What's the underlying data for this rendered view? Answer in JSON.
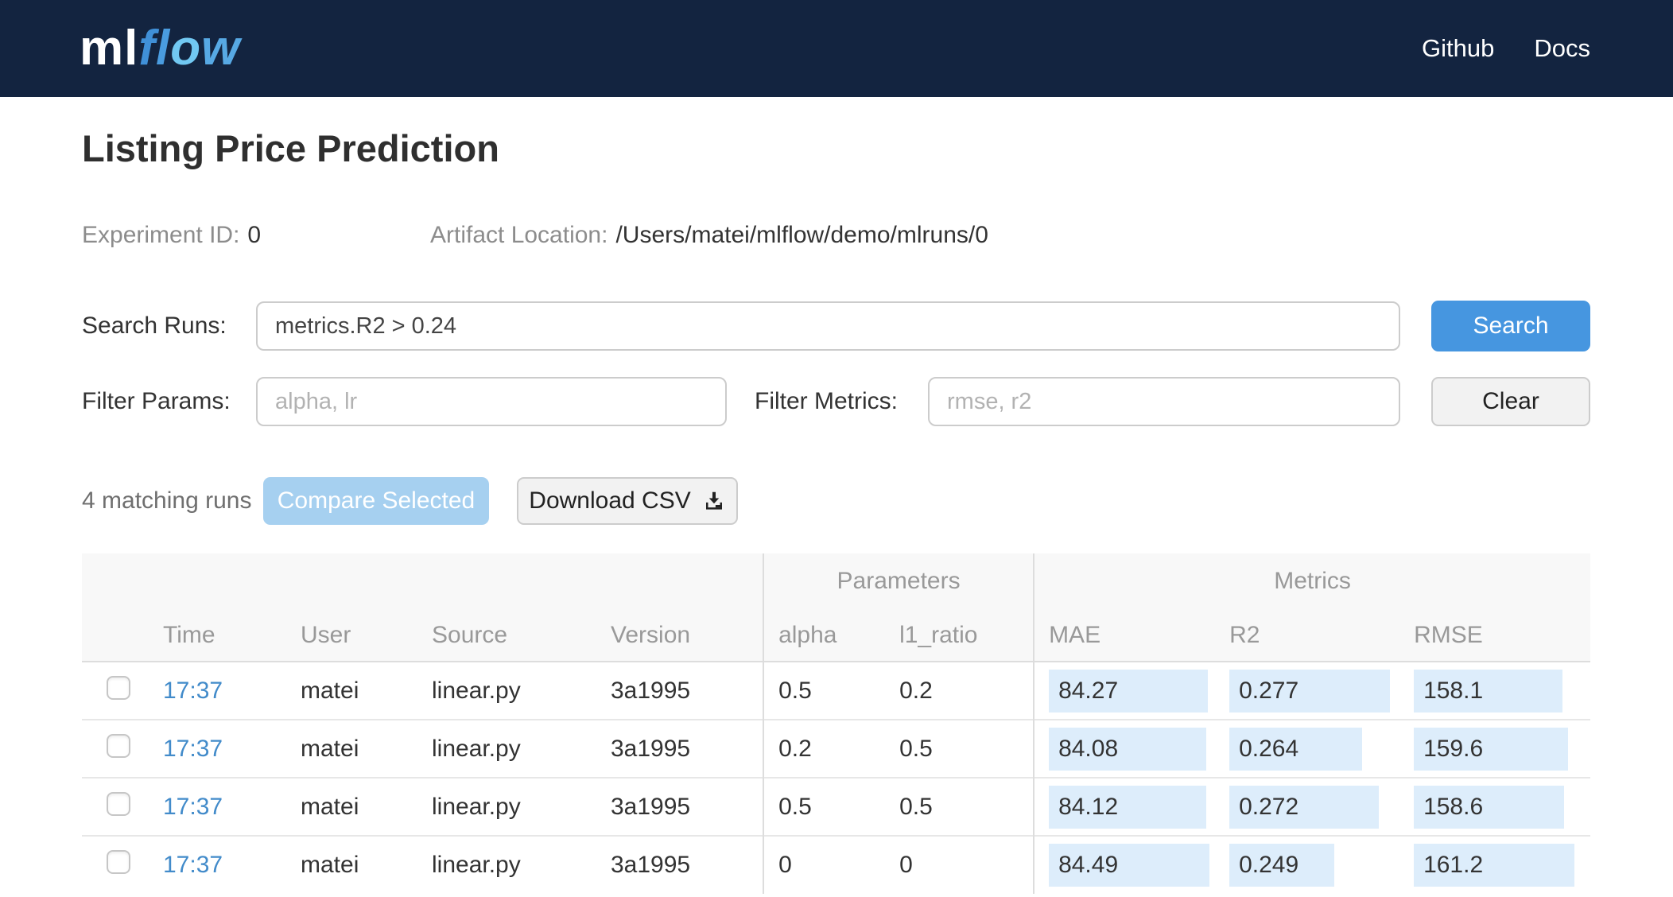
{
  "navbar": {
    "logo": {
      "ml": "ml",
      "flow_letters": [
        "f",
        "l",
        "o",
        "w"
      ]
    },
    "links": [
      {
        "label": "Github"
      },
      {
        "label": "Docs"
      }
    ]
  },
  "header": {
    "title": "Listing Price Prediction",
    "experiment_id_label": "Experiment ID:",
    "experiment_id_value": "0",
    "artifact_location_label": "Artifact Location:",
    "artifact_location_value": "/Users/matei/mlflow/demo/mlruns/0"
  },
  "search": {
    "label": "Search Runs:",
    "value": "metrics.R2 > 0.24",
    "button_label": "Search"
  },
  "filters": {
    "params_label": "Filter Params:",
    "params_placeholder": "alpha, lr",
    "metrics_label": "Filter Metrics:",
    "metrics_placeholder": "rmse, r2",
    "clear_button_label": "Clear"
  },
  "actions": {
    "matching_runs_text": "4 matching runs",
    "compare_button_label": "Compare Selected",
    "download_button_label": "Download CSV"
  },
  "table": {
    "group_headers": {
      "parameters": "Parameters",
      "metrics": "Metrics"
    },
    "columns": [
      "Time",
      "User",
      "Source",
      "Version",
      "alpha",
      "l1_ratio",
      "MAE",
      "R2",
      "RMSE"
    ],
    "runs": [
      {
        "time": "17:37",
        "user": "matei",
        "source": "linear.py",
        "version": "3a1995",
        "alpha": "0.5",
        "l1_ratio": "0.2",
        "mae": "84.27",
        "r2": "0.277",
        "rmse": "158.1"
      },
      {
        "time": "17:37",
        "user": "matei",
        "source": "linear.py",
        "version": "3a1995",
        "alpha": "0.2",
        "l1_ratio": "0.5",
        "mae": "84.08",
        "r2": "0.264",
        "rmse": "159.6"
      },
      {
        "time": "17:37",
        "user": "matei",
        "source": "linear.py",
        "version": "3a1995",
        "alpha": "0.5",
        "l1_ratio": "0.5",
        "mae": "84.12",
        "r2": "0.272",
        "rmse": "158.6"
      },
      {
        "time": "17:37",
        "user": "matei",
        "source": "linear.py",
        "version": "3a1995",
        "alpha": "0",
        "l1_ratio": "0",
        "mae": "84.49",
        "r2": "0.249",
        "rmse": "161.2"
      }
    ]
  },
  "colors": {
    "navbar_bg": "#132440",
    "primary_blue": "#4696e0",
    "link_blue": "#428bca",
    "metric_bar_bg": "#ddedfb",
    "compare_disabled_bg": "#a6d0f0",
    "logo_f": "#4090d8",
    "logo_l": "#4a9ce0",
    "logo_o": "#71c8f2",
    "logo_w": "#57a9e4"
  }
}
